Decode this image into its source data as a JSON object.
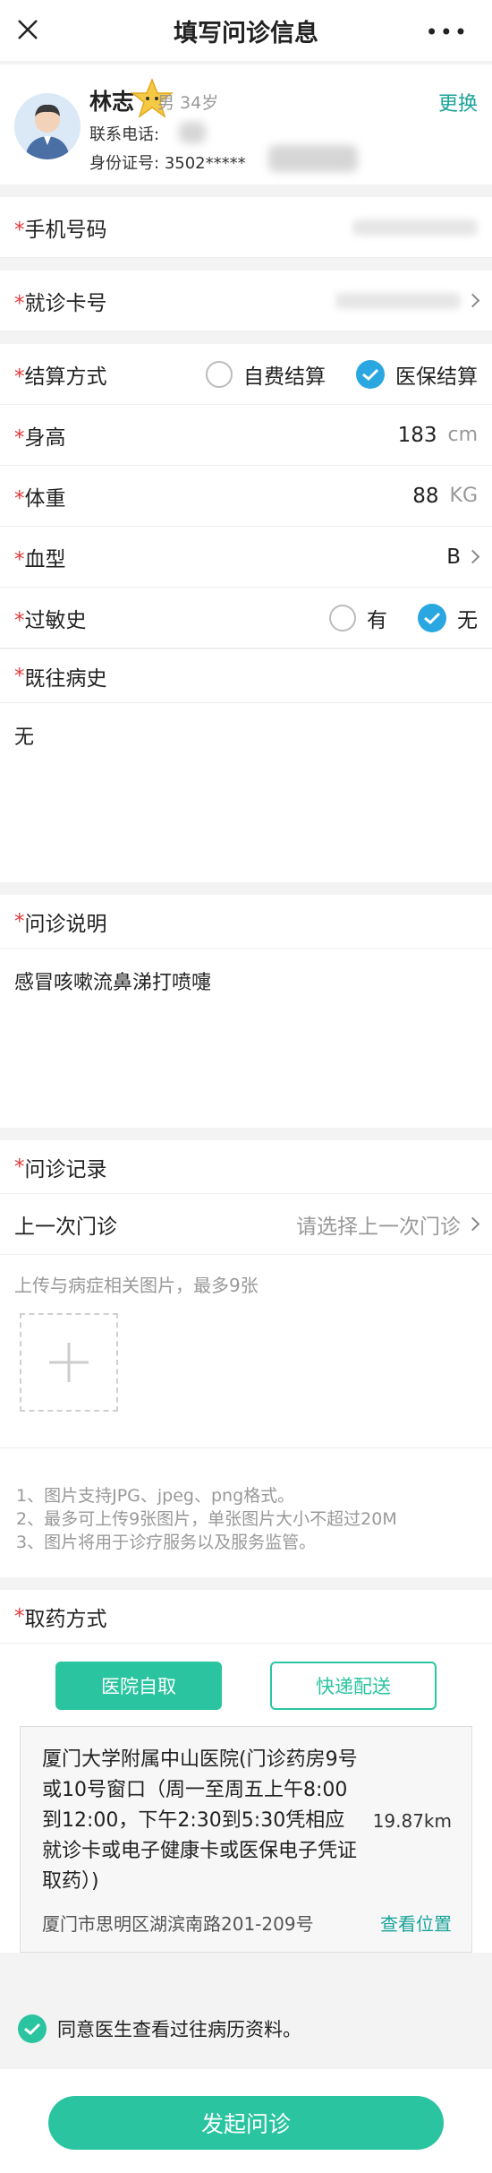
{
  "header": {
    "title": "填写问诊信息",
    "more": "•••"
  },
  "patient": {
    "name": "林志",
    "sex_age": "男 34岁",
    "phone_label": "联系电话:",
    "id_label": "身份证号:",
    "id_value": "3502*****",
    "change": "更换"
  },
  "rows": {
    "phone": {
      "label": "手机号码"
    },
    "card": {
      "label": "就诊卡号"
    },
    "settle": {
      "label": "结算方式",
      "opt1": "自费结算",
      "opt2": "医保结算"
    },
    "height": {
      "label": "身高",
      "value": "183",
      "unit": "cm"
    },
    "weight": {
      "label": "体重",
      "value": "88",
      "unit": "KG"
    },
    "blood": {
      "label": "血型",
      "value": "B"
    },
    "allergy": {
      "label": "过敏史",
      "opt1": "有",
      "opt2": "无"
    }
  },
  "history": {
    "title": "既往病史",
    "value": "无"
  },
  "desc": {
    "title": "问诊说明",
    "value": "感冒咳嗽流鼻涕打喷嚏"
  },
  "record": {
    "title": "问诊记录",
    "last_label": "上一次门诊",
    "last_placeholder": "请选择上一次门诊",
    "upload_hint": "上传与病症相关图片，最多9张",
    "note1": "1、图片支持JPG、jpeg、png格式。",
    "note2": "2、最多可上传9张图片，单张图片大小不超过20M",
    "note3": "3、图片将用于诊疗服务以及服务监管。"
  },
  "pickup": {
    "title": "取药方式",
    "opt1": "医院自取",
    "opt2": "快递配送",
    "address": "厦门大学附属中山医院(门诊药房9号或10号窗口（周一至周五上午8:00到12:00，下午2:30到5:30凭相应就诊卡或电子健康卡或医保电子凭证取药）)",
    "distance": "19.87km",
    "street": "厦门市思明区湖滨南路201-209号",
    "locate": "查看位置"
  },
  "agree": "同意医生查看过往病历资料。",
  "submit": "发起问诊",
  "required_mark": "*",
  "colors": {
    "accent": "#2bc4a0",
    "blue": "#2aa7e0",
    "required": "#e23a3a"
  }
}
